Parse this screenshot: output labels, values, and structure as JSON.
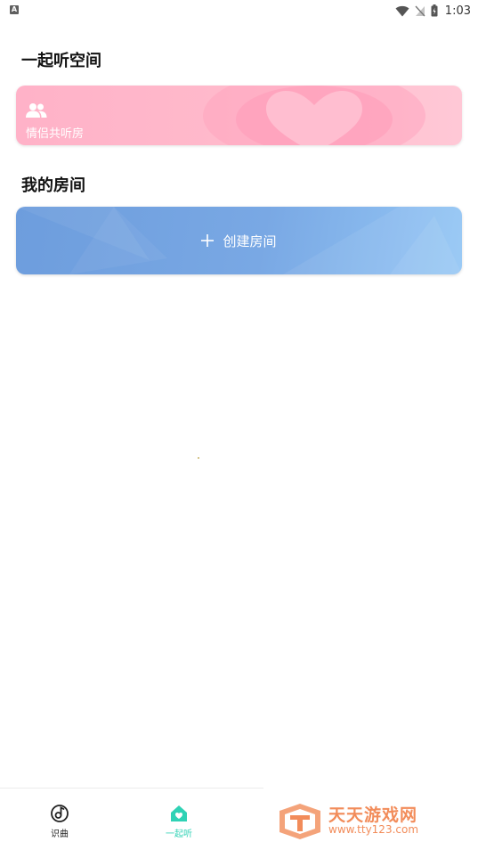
{
  "status_bar": {
    "notification_icon_letter": "A",
    "time": "1:03",
    "icons": [
      "wifi-icon",
      "signal-off-icon",
      "battery-icon"
    ]
  },
  "space_section": {
    "title": "一起听空间",
    "couple_card": {
      "label": "情侣共听房",
      "icon": "people-icon",
      "accent": "#ffb2c8"
    }
  },
  "my_rooms_section": {
    "title": "我的房间",
    "create_card": {
      "label": "创建房间",
      "icon": "plus-icon",
      "accent": "#79a8e4"
    }
  },
  "bottom_nav": {
    "items": [
      {
        "label": "识曲",
        "icon": "music-note-icon",
        "active": false
      },
      {
        "label": "一起听",
        "icon": "home-heart-icon",
        "active": true
      }
    ],
    "active_color": "#2fd2b5"
  },
  "watermark": {
    "title": "天天游戏网",
    "url": "www.tty123.com",
    "color": "#f28c5a"
  }
}
